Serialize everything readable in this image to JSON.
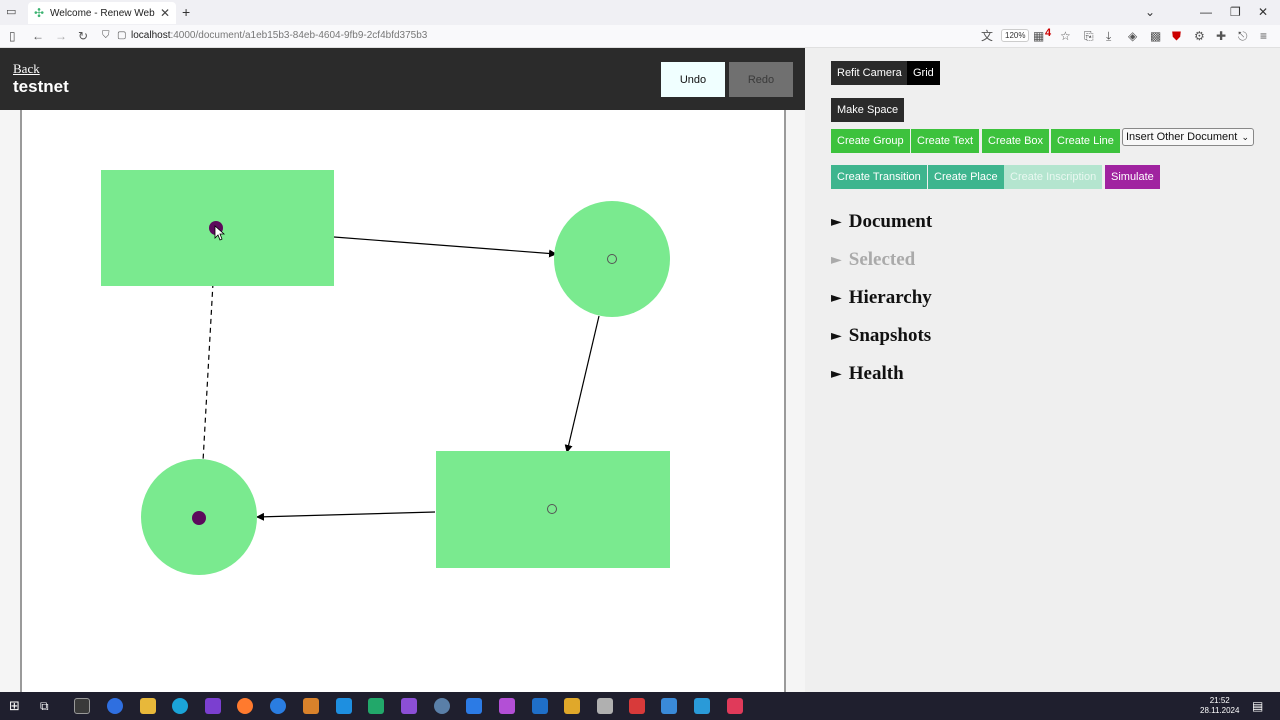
{
  "browser": {
    "tab_title": "Welcome - Renew Web",
    "url_host": "localhost",
    "url_path": ":4000/document/a1eb15b3-84eb-4604-9fb9-2cf4bfd375b3",
    "zoom": "120%",
    "ext_badge": "4"
  },
  "header": {
    "back_label": "Back",
    "title": "testnet",
    "undo_label": "Undo",
    "redo_label": "Redo"
  },
  "panel": {
    "refit_label": "Refit Camera",
    "grid_label": "Grid",
    "make_space_label": "Make Space",
    "create_group_label": "Create Group",
    "create_text_label": "Create Text",
    "create_box_label": "Create Box",
    "create_line_label": "Create Line",
    "insert_doc_label": "Insert Other Document",
    "create_transition_label": "Create Transition",
    "create_place_label": "Create Place",
    "create_inscription_label": "Create Inscription",
    "simulate_label": "Simulate",
    "sections": {
      "document": "Document",
      "selected": "Selected",
      "hierarchy": "Hierarchy",
      "snapshots": "Snapshots",
      "health": "Health"
    }
  },
  "taskbar": {
    "time": "21:52",
    "date": "28.11.2024"
  },
  "colors": {
    "node_fill": "#7aea8f",
    "token": "#5c0a5c",
    "header_bg": "#2b2b2b"
  }
}
